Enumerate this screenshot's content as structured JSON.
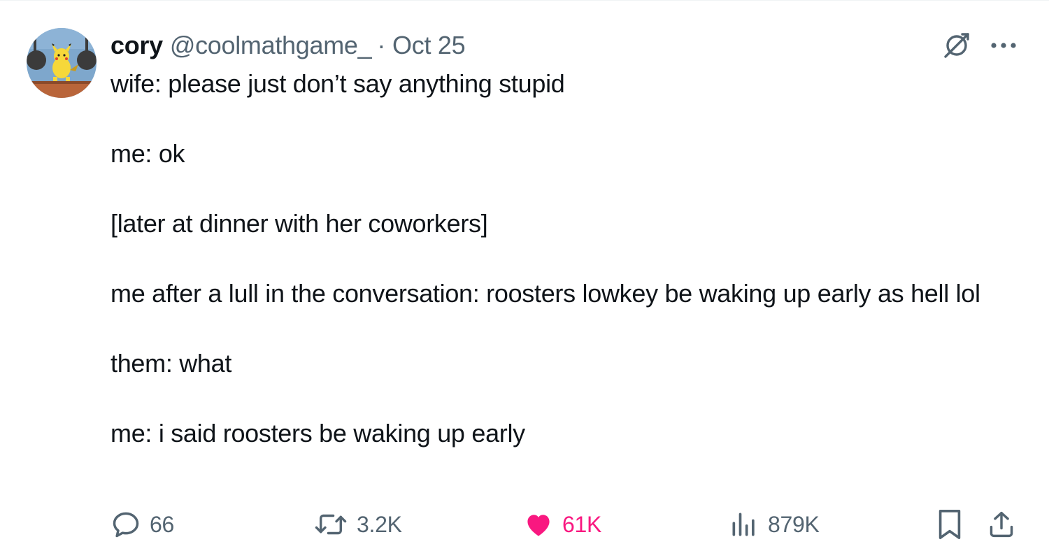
{
  "tweet": {
    "author": {
      "display_name": "cory",
      "handle": "@coolmathgame_",
      "separator": "·",
      "date": "Oct 25",
      "avatar_icon": "pikachu-avatar-icon"
    },
    "header_icons": {
      "grok": "grok-icon",
      "more": "more-icon"
    },
    "text_lines": [
      "wife: please just don’t say anything stupid",
      "me: ok",
      "[later at dinner with her coworkers]",
      "me after a lull in the conversation: roosters lowkey be waking up early as hell lol",
      "them: what",
      "me: i said roosters be waking up early"
    ],
    "actions": {
      "reply": {
        "icon": "reply-icon",
        "count": "66"
      },
      "retweet": {
        "icon": "retweet-icon",
        "count": "3.2K"
      },
      "like": {
        "icon": "heart-icon",
        "count": "61K",
        "active": true
      },
      "views": {
        "icon": "views-icon",
        "count": "879K"
      },
      "bookmark": {
        "icon": "bookmark-icon"
      },
      "share": {
        "icon": "share-icon"
      }
    },
    "colors": {
      "text": "#0f1419",
      "secondary": "#536471",
      "like_active": "#f91880"
    }
  }
}
